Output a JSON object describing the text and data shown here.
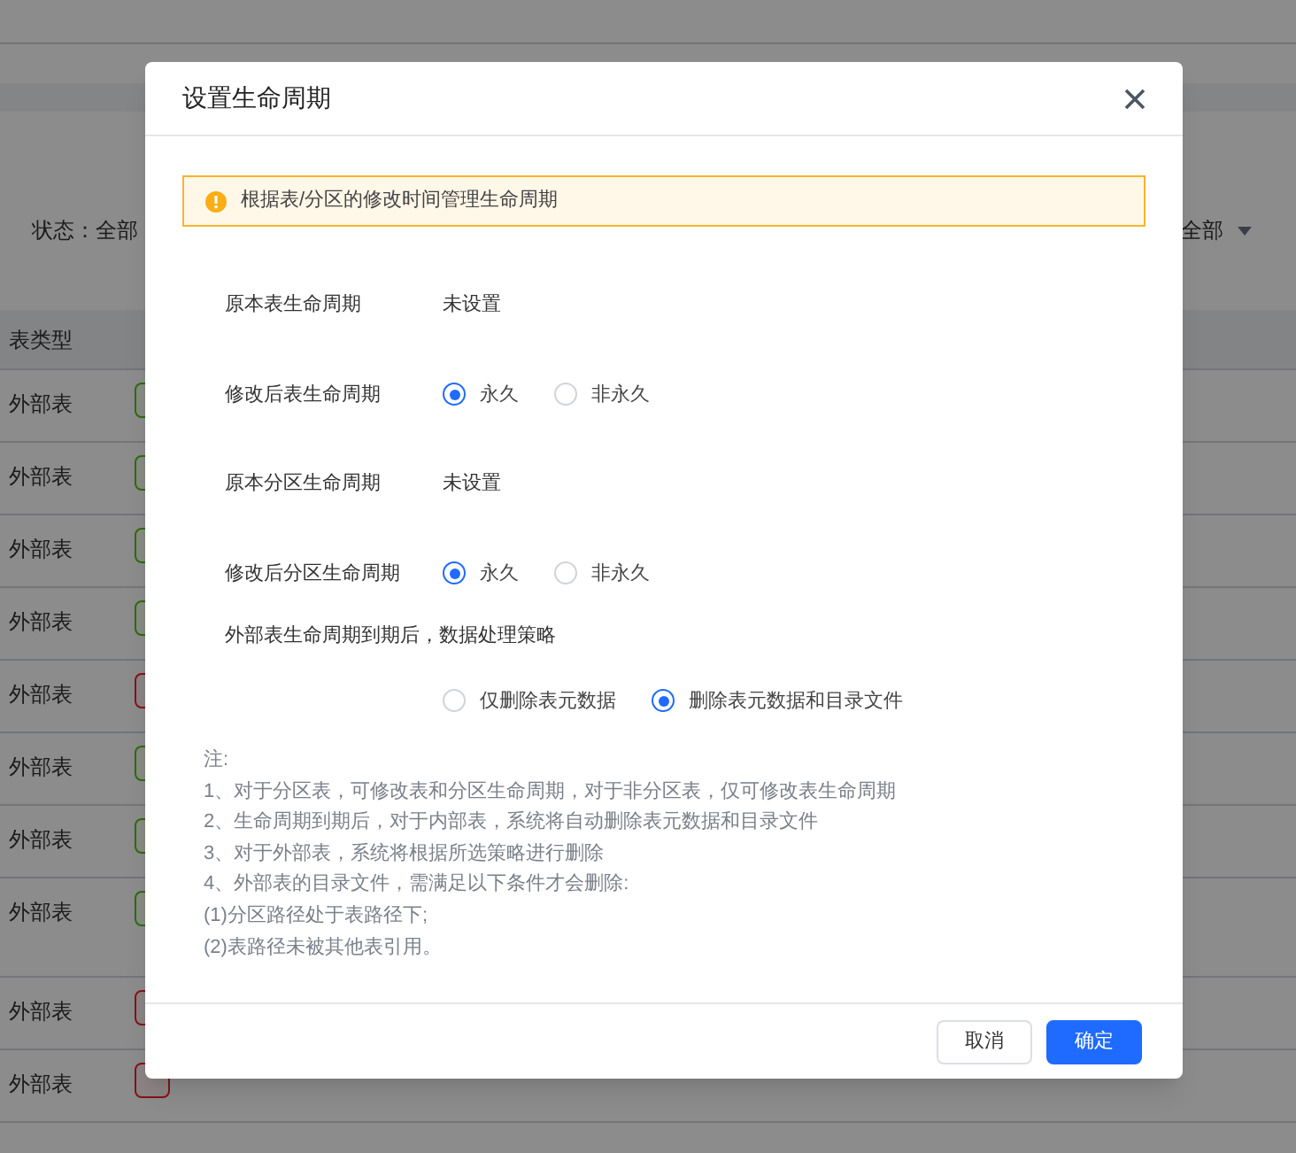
{
  "background": {
    "filter_label": "状态：全部",
    "filter_right": "全部",
    "table_header": "表类型",
    "rows": [
      {
        "type": "外部表",
        "kind": "normal"
      },
      {
        "type": "外部表",
        "kind": "normal"
      },
      {
        "type": "外部表",
        "kind": "normal"
      },
      {
        "type": "外部表",
        "kind": "normal"
      },
      {
        "type": "外部表",
        "kind": "warning"
      },
      {
        "type": "外部表",
        "kind": "normal"
      },
      {
        "type": "外部表",
        "kind": "normal"
      },
      {
        "type": "外部表",
        "kind": "normal"
      },
      {
        "type": "外部表",
        "kind": "warning"
      },
      {
        "type": "外部表",
        "kind": "warning"
      }
    ]
  },
  "dialog": {
    "title": "设置生命周期",
    "alert": "根据表/分区的修改时间管理生命周期",
    "fields": [
      {
        "kind": "text",
        "label": "原本表生命周期",
        "value": "未设置"
      },
      {
        "kind": "radio",
        "label": "修改后表生命周期",
        "options": [
          {
            "label": "永久",
            "selected": true
          },
          {
            "label": "非永久",
            "selected": false
          }
        ]
      },
      {
        "kind": "text",
        "label": "原本分区生命周期",
        "value": "未设置"
      },
      {
        "kind": "radio",
        "label": "修改后分区生命周期",
        "options": [
          {
            "label": "永久",
            "selected": true
          },
          {
            "label": "非永久",
            "selected": false
          }
        ]
      }
    ],
    "strategy": {
      "label": "外部表生命周期到期后，数据处理策略",
      "options": [
        {
          "label": "仅删除表元数据",
          "selected": false
        },
        {
          "label": "删除表元数据和目录文件",
          "selected": true
        }
      ]
    },
    "notes": [
      "注:",
      "1、对于分区表，可修改表和分区生命周期，对于非分区表，仅可修改表生命周期",
      "2、生命周期到期后，对于内部表，系统将自动删除表元数据和目录文件",
      "3、对于外部表，系统将根据所选策略进行删除",
      "4、外部表的目录文件，需满足以下条件才会删除:",
      "(1)分区路径处于表路径下;",
      "(2)表路径未被其他表引用。"
    ],
    "buttons": [
      {
        "kind": "secondary",
        "label": "取消"
      },
      {
        "kind": "primary",
        "label": "确定"
      }
    ]
  }
}
